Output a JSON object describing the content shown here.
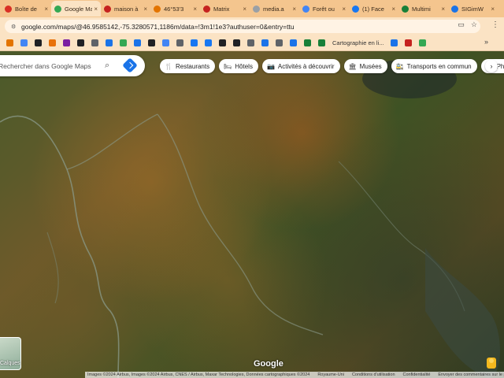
{
  "tabs": [
    {
      "label": "Boîte de",
      "color": "#d93025",
      "active": false
    },
    {
      "label": "Google Maps",
      "color": "#34a853",
      "active": true
    },
    {
      "label": "maison à",
      "color": "#c5221f",
      "active": false
    },
    {
      "label": "46°53'3",
      "color": "#e37400",
      "active": false
    },
    {
      "label": "Matrix",
      "color": "#c5221f",
      "active": false
    },
    {
      "label": "media.a",
      "color": "#9aa0a6",
      "active": false
    },
    {
      "label": "Forêt ou",
      "color": "#4285f4",
      "active": false
    },
    {
      "label": "(1) Face",
      "color": "#1877f2",
      "active": false
    },
    {
      "label": "Multimi",
      "color": "#188038",
      "active": false
    },
    {
      "label": "SIGimW",
      "color": "#1a73e8",
      "active": false
    }
  ],
  "tab_close": "×",
  "address": {
    "url": "google.com/maps/@46.9585142,-75.3280571,1186m/data=!3m1!1e3?authuser=0&entry=ttu"
  },
  "bookmarks": {
    "icon_colors": [
      "#e37400",
      "#4285f4",
      "#202124",
      "#e8710a",
      "#7b1fa2",
      "#202124",
      "#5f6368",
      "#1a73e8",
      "#34a853",
      "#1a73e8",
      "#202124",
      "#4285f4",
      "#5f6368",
      "#1877f2",
      "#1877f2",
      "#202124",
      "#202124",
      "#5f6368",
      "#1a73e8",
      "#5f6368",
      "#1a73e8",
      "#188038",
      "#188038",
      "#1a73e8",
      "#c5221f",
      "#34a853"
    ],
    "label": "Cartographie en li...",
    "more": "»"
  },
  "search": {
    "placeholder": "Rechercher dans Google Maps"
  },
  "chips": [
    {
      "label": "Restaurants",
      "icon": "fork-knife-icon",
      "glyph": "🍴"
    },
    {
      "label": "Hôtels",
      "icon": "bed-icon",
      "glyph": "🛏"
    },
    {
      "label": "Activités à découvrir",
      "icon": "camera-icon",
      "glyph": "📷"
    },
    {
      "label": "Musées",
      "icon": "museum-icon",
      "glyph": "🏛"
    },
    {
      "label": "Transports en commun",
      "icon": "transit-icon",
      "glyph": "🚉"
    },
    {
      "label": "Pharma",
      "icon": "pharmacy-icon",
      "glyph": "💊"
    }
  ],
  "chip_next": "›",
  "layers_label": "Calques",
  "logo": "Google",
  "footer": [
    "Images ©2024 Airbus, Images ©2024 Airbus, CNES / Airbus, Maxar Technologies, Données cartographiques ©2024",
    "Royaume-Uni",
    "Conditions d'utilisation",
    "Confidentialité",
    "Envoyer des commentaires sur le produit"
  ]
}
